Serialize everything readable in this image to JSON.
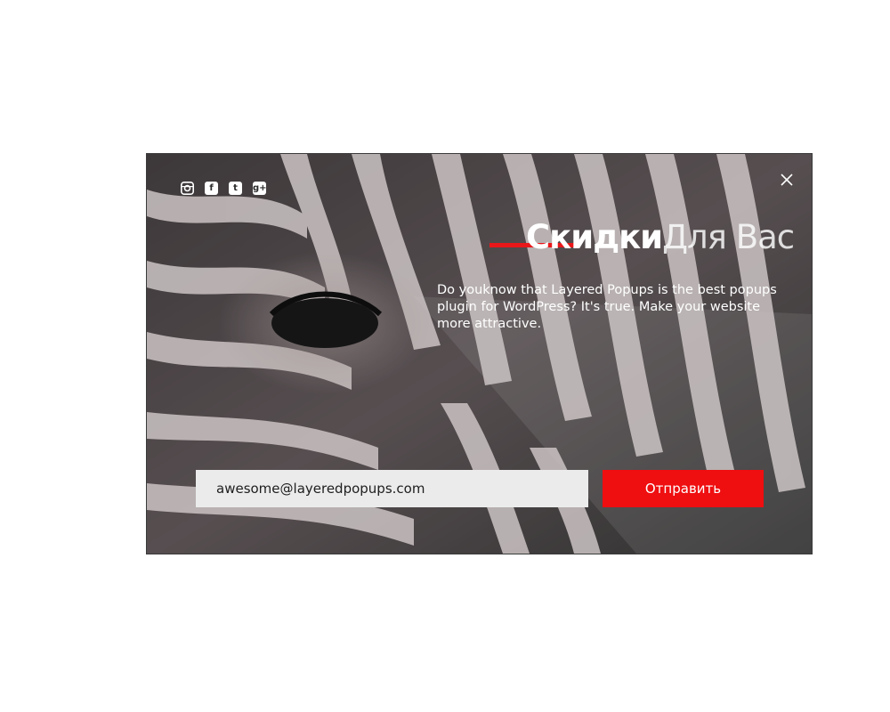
{
  "popup": {
    "background_image": "zebra-photo",
    "social": [
      {
        "name": "instagram",
        "glyph": ""
      },
      {
        "name": "facebook",
        "glyph": "f"
      },
      {
        "name": "twitter",
        "glyph": "t"
      },
      {
        "name": "google-plus",
        "glyph": "g+"
      }
    ],
    "close_icon": "close-icon",
    "headline": {
      "bold": "Скидки",
      "light": "Для Вас"
    },
    "description": "Do youknow that Layered Popups is the best popups plugin for WordPress? It's true. Make your website more attractive.",
    "email_placeholder": "awesome@layeredpopups.com",
    "submit_label": "Отправить"
  },
  "colors": {
    "accent": "#e9171a",
    "button": "#ef0e10",
    "input_bg": "#ebebeb",
    "text_light": "#ffffff"
  }
}
